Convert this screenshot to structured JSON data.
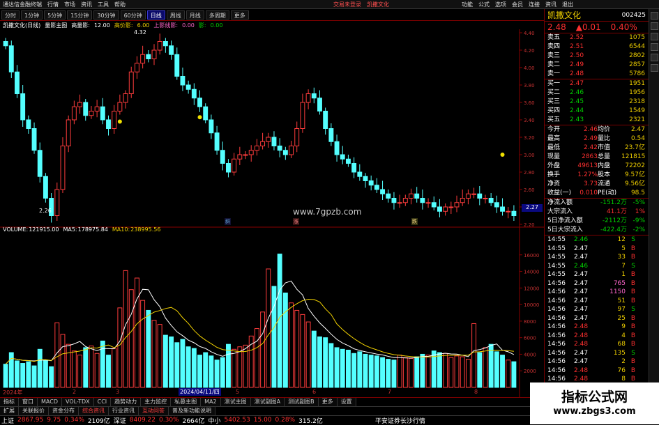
{
  "titlebar": {
    "app_name": "通达信金融终端",
    "menus": [
      "行情",
      "市场",
      "资讯",
      "工具",
      "帮助"
    ],
    "center_notice": "交易未登录",
    "center_stock": "凯撒文化",
    "right_menus": [
      "功能",
      "公式",
      "选项",
      "会员",
      "连接",
      "资讯",
      "退出"
    ]
  },
  "periods": [
    "分时",
    "1分钟",
    "5分钟",
    "15分钟",
    "30分钟",
    "60分钟",
    "日线",
    "周线",
    "月线",
    "多周期",
    "更多"
  ],
  "active_period": "日线",
  "kline_header": {
    "name": "凯撒文化(日线)",
    "label1": "量影主图",
    "label2": "高量影:",
    "v1": "12.00",
    "label3": "高价影:",
    "v3": "6.00",
    "label4": "上影线影:",
    "v4": "0.00",
    "label5": "影:",
    "v5": "0.00"
  },
  "price_axis": [
    "4.40",
    "4.20",
    "4.00",
    "3.80",
    "3.60",
    "3.40",
    "3.20",
    "3.00",
    "2.80",
    "2.60",
    "2.40",
    "2.20"
  ],
  "current_price_tag": "2.27",
  "price_high_marker": "4.32",
  "price_low_marker": "2.26",
  "event_markers": [
    "斜",
    "涨",
    "跌"
  ],
  "watermark": "www.7gpzb.com",
  "volume_header": {
    "label": "VOLUME:",
    "value": "121915.00",
    "ma5_label": "MA5:",
    "ma5": "178975.84",
    "ma10_label": "MA10:",
    "ma10": "238995.56"
  },
  "volume_axis": [
    "16000",
    "14000",
    "12000",
    "10000",
    "8000",
    "6000",
    "4000",
    "2000"
  ],
  "time_axis": [
    "2024年",
    "2",
    "3",
    "2024/04/11/四",
    "5",
    "6",
    "7",
    "8"
  ],
  "chart_data": {
    "type": "bar",
    "title": "",
    "price_range": [
      2.2,
      4.4
    ],
    "volume_range": [
      0,
      18000
    ],
    "candles_close": [
      4.25,
      3.95,
      3.7,
      3.4,
      3.3,
      3.05,
      2.75,
      2.5,
      2.3,
      2.6,
      3.1,
      3.4,
      3.55,
      3.6,
      3.45,
      3.5,
      3.55,
      3.4,
      3.3,
      3.5,
      3.6,
      3.7,
      3.95,
      4.05,
      4.15,
      4.1,
      4.2,
      4.3,
      4.25,
      4.15,
      3.9,
      3.8,
      3.75,
      3.65,
      3.55,
      3.4,
      3.25,
      3.05,
      2.9,
      2.8,
      2.95,
      3.0,
      3.0,
      3.05,
      3.1,
      3.15,
      3.2,
      3.1,
      3.05,
      3.0,
      3.1,
      3.3,
      3.6,
      3.7,
      3.65,
      3.5,
      3.3,
      3.15,
      3.0,
      2.95,
      2.9,
      2.8,
      2.75,
      2.7,
      2.65,
      2.6,
      2.55,
      2.5,
      2.45,
      2.45,
      2.5,
      2.55,
      2.5,
      2.45,
      2.45,
      2.4,
      2.35,
      2.4,
      2.4,
      2.45,
      2.5,
      2.55,
      2.55,
      2.5,
      2.5,
      2.45,
      2.4,
      2.35,
      2.35,
      2.3
    ],
    "volumes": [
      2800,
      4200,
      3200,
      2900,
      3100,
      2600,
      4600,
      3300,
      2500,
      7800,
      6400,
      5200,
      4400,
      3900,
      4800,
      5000,
      4100,
      5600,
      3900,
      4700,
      9600,
      14100,
      11800,
      13200,
      10500,
      9300,
      8100,
      7600,
      6300,
      6100,
      5400,
      5800,
      4900,
      4700,
      3900,
      4200,
      3800,
      3300,
      3600,
      5200,
      4600,
      4900,
      5100,
      6200,
      7100,
      9100,
      14300,
      12200,
      16100,
      11400,
      10200,
      9300,
      8800,
      7900,
      6800,
      6100,
      6000,
      5300,
      4800,
      4600,
      4500,
      4100,
      4300,
      4000,
      3900,
      3800,
      3600,
      3400,
      3300,
      3900,
      3600,
      3500,
      3700,
      4000,
      3900,
      4400,
      4200,
      4100,
      3600,
      3800,
      3700,
      3400,
      7700,
      4200,
      4800,
      5200,
      4300,
      3900,
      3300,
      3100
    ],
    "volume_text_labels": [
      "16000",
      "14000",
      "12000",
      "10000",
      "8000",
      "6000",
      "4000",
      "2000"
    ]
  },
  "quote": {
    "code_name": "凯撒文化",
    "code": "002425",
    "price": "2.48",
    "change": "▲0.01",
    "change_pct": "0.40%",
    "sell": [
      {
        "label": "卖五",
        "price": "2.52",
        "vol": "1075"
      },
      {
        "label": "卖四",
        "price": "2.51",
        "vol": "6544"
      },
      {
        "label": "卖三",
        "price": "2.50",
        "vol": "2802"
      },
      {
        "label": "卖二",
        "price": "2.49",
        "vol": "2857"
      },
      {
        "label": "卖一",
        "price": "2.48",
        "vol": "5786"
      }
    ],
    "buy": [
      {
        "label": "买一",
        "price": "2.47",
        "vol": "1951"
      },
      {
        "label": "买二",
        "price": "2.46",
        "vol": "1956"
      },
      {
        "label": "买三",
        "price": "2.45",
        "vol": "2318"
      },
      {
        "label": "买四",
        "price": "2.44",
        "vol": "1549"
      },
      {
        "label": "买五",
        "price": "2.43",
        "vol": "2321"
      }
    ],
    "stats": [
      [
        "今开",
        "2.46",
        "均价",
        "2.47"
      ],
      [
        "最高",
        "2.49",
        "量比",
        "0.54"
      ],
      [
        "最低",
        "2.42",
        "市值",
        "23.7亿"
      ],
      [
        "现量",
        "2863",
        "总量",
        "121815"
      ],
      [
        "外盘",
        "49613",
        "内盘",
        "72202"
      ]
    ],
    "stats2": [
      [
        "换手",
        "1.27%",
        "股本",
        "9.57亿"
      ],
      [
        "净资",
        "3.73",
        "流通",
        "9.56亿"
      ],
      [
        "收益(一)",
        "0.010",
        "PE(动)",
        "98.5"
      ]
    ],
    "flows": [
      {
        "label": "净流入额",
        "value": "-151.2万",
        "pct": "-5%"
      },
      {
        "label": "大宗流入",
        "value": "41.1万",
        "pct": "1%"
      },
      {
        "label": "5日净流入额",
        "value": "-2112万",
        "pct": "-9%"
      },
      {
        "label": "5日大宗流入",
        "value": "-422.4万",
        "pct": "-2%"
      }
    ],
    "ticks": [
      [
        "14:55",
        "2.46",
        "12",
        "S"
      ],
      [
        "14:55",
        "2.47",
        "5",
        "B"
      ],
      [
        "14:55",
        "2.47",
        "33",
        "B"
      ],
      [
        "14:55",
        "2.46",
        "7",
        "S"
      ],
      [
        "14:55",
        "2.47",
        "1",
        "B"
      ],
      [
        "14:56",
        "2.47",
        "765",
        "B"
      ],
      [
        "14:56",
        "2.47",
        "1150",
        "B"
      ],
      [
        "14:56",
        "2.47",
        "51",
        "B"
      ],
      [
        "14:56",
        "2.47",
        "97",
        "S"
      ],
      [
        "14:56",
        "2.47",
        "25",
        "B"
      ],
      [
        "14:56",
        "2.48",
        "9",
        "B"
      ],
      [
        "14:56",
        "2.48",
        "4",
        "B"
      ],
      [
        "14:56",
        "2.48",
        "68",
        "B"
      ],
      [
        "14:56",
        "2.47",
        "135",
        "S"
      ],
      [
        "14:56",
        "2.47",
        "2",
        "B"
      ],
      [
        "14:56",
        "2.48",
        "76",
        "B"
      ],
      [
        "14:56",
        "2.48",
        "8",
        "B"
      ]
    ]
  },
  "bottom_tabs": [
    "指标",
    "窗口",
    "MACD",
    "VOL-TDX",
    "CCI",
    "趋势动力",
    "主力监控",
    "私募主图",
    "MA2",
    "测试主图",
    "测试副图A",
    "测试副图B",
    "更多",
    "设置"
  ],
  "bottom_tabs2": [
    "扩展",
    "关联报价",
    "资金分布",
    "综合资讯",
    "行业资讯",
    "互动问答",
    "普及新功能说明"
  ],
  "statusbar": [
    {
      "name": "上证",
      "value": "2867.95",
      "chg": "9.75",
      "pct": "0.34%",
      "amt": "2109亿"
    },
    {
      "name": "深证",
      "value": "8409.22",
      "chg": "",
      "pct": "0.30%",
      "amt": "2664亿"
    },
    {
      "name": "中小",
      "value": "5402.53",
      "chg": "15.00",
      "pct": "0.28%",
      "amt": "315.2亿"
    }
  ],
  "statusbar_right": "平安证券长沙行情",
  "zbgs": {
    "title": "指标公式网",
    "url": "www.zbgs3.com"
  }
}
